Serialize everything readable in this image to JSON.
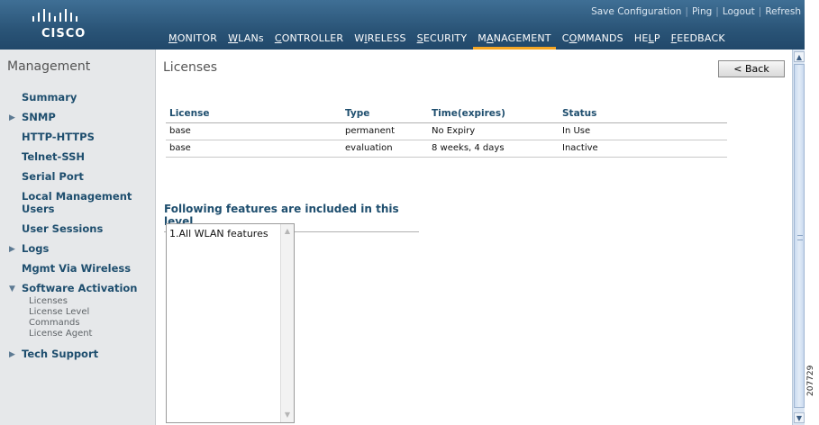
{
  "header": {
    "logo_text": "CISCO",
    "top_links": [
      "Save Configuration",
      "Ping",
      "Logout",
      "Refresh"
    ],
    "nav": [
      {
        "label": "MONITOR",
        "underline_char": "M",
        "active": false
      },
      {
        "label": "WLANs",
        "underline_char": "W",
        "active": false
      },
      {
        "label": "CONTROLLER",
        "underline_char": "C",
        "active": false
      },
      {
        "label": "WIRELESS",
        "underline_char": "I",
        "active": false
      },
      {
        "label": "SECURITY",
        "underline_char": "S",
        "active": false
      },
      {
        "label": "MANAGEMENT",
        "underline_char": "A",
        "active": true
      },
      {
        "label": "COMMANDS",
        "underline_char": "O",
        "active": false
      },
      {
        "label": "HELP",
        "underline_char": "L",
        "active": false
      },
      {
        "label": "FEEDBACK",
        "underline_char": "F",
        "active": false
      }
    ],
    "accent_color": "#f5a623"
  },
  "sidebar": {
    "title": "Management",
    "items": [
      {
        "label": "Summary",
        "expandable": false
      },
      {
        "label": "SNMP",
        "expandable": true
      },
      {
        "label": "HTTP-HTTPS",
        "expandable": false
      },
      {
        "label": "Telnet-SSH",
        "expandable": false
      },
      {
        "label": "Serial Port",
        "expandable": false
      },
      {
        "label": "Local Management Users",
        "expandable": false
      },
      {
        "label": "User Sessions",
        "expandable": false
      },
      {
        "label": "Logs",
        "expandable": true
      },
      {
        "label": "Mgmt Via Wireless",
        "expandable": false
      },
      {
        "label": "Software Activation",
        "expandable": true,
        "expanded": true,
        "children": [
          "Licenses",
          "License Level",
          "Commands",
          "License Agent"
        ]
      },
      {
        "label": "Tech Support",
        "expandable": true
      }
    ]
  },
  "main": {
    "page_title": "Licenses",
    "back_button": "< Back",
    "table": {
      "headers": [
        "License",
        "Type",
        "Time(expires)",
        "Status"
      ],
      "rows": [
        [
          "base",
          "permanent",
          "No Expiry",
          "In Use"
        ],
        [
          "base",
          "evaluation",
          "8 weeks, 4 days",
          "Inactive"
        ]
      ]
    },
    "features_heading": "Following features are included in this level",
    "features_list": "1.All WLAN features"
  },
  "figure_id": "207729"
}
